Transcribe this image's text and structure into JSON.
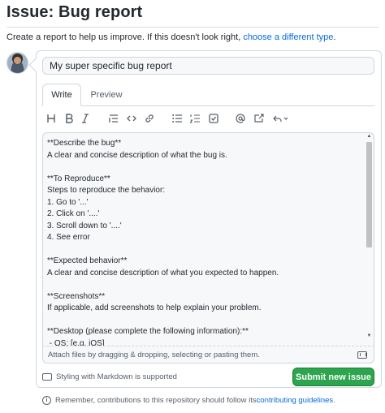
{
  "header": {
    "title": "Issue: Bug report",
    "intro_text": "Create a report to help us improve. If this doesn't look right, ",
    "intro_link": "choose a different type",
    "intro_end": "."
  },
  "issue_title_input": {
    "value": "My super specific bug report"
  },
  "tabs": [
    {
      "label": "Write",
      "selected": true
    },
    {
      "label": "Preview",
      "selected": false
    }
  ],
  "toolbar": [
    "heading-icon",
    "bold-icon",
    "italic-icon",
    "quote-icon",
    "code-icon",
    "link-icon",
    "unordered-list-icon",
    "ordered-list-icon",
    "task-list-icon",
    "mention-icon",
    "reference-icon",
    "saved-replies-icon"
  ],
  "editor": {
    "content": "**Describe the bug**\nA clear and concise description of what the bug is.\n\n**To Reproduce**\nSteps to reproduce the behavior:\n1. Go to '...'\n2. Click on '....'\n3. Scroll down to '....'\n4. See error\n\n**Expected behavior**\nA clear and concise description of what you expected to happen.\n\n**Screenshots**\nIf applicable, add screenshots to help explain your problem.\n\n**Desktop (please complete the following information):**\n - OS: [e.g. iOS]"
  },
  "attach": {
    "text": "Attach files by dragging & dropping, selecting or pasting them."
  },
  "markdown_note": "Styling with Markdown is supported",
  "submit_label": "Submit new issue",
  "footer": {
    "text": "Remember, contributions to this repository should follow its ",
    "link": "contributing guidelines",
    "end": "."
  },
  "colors": {
    "accent_link": "#0969da",
    "submit_green": "#2da44e",
    "border": "#d0d7de"
  }
}
